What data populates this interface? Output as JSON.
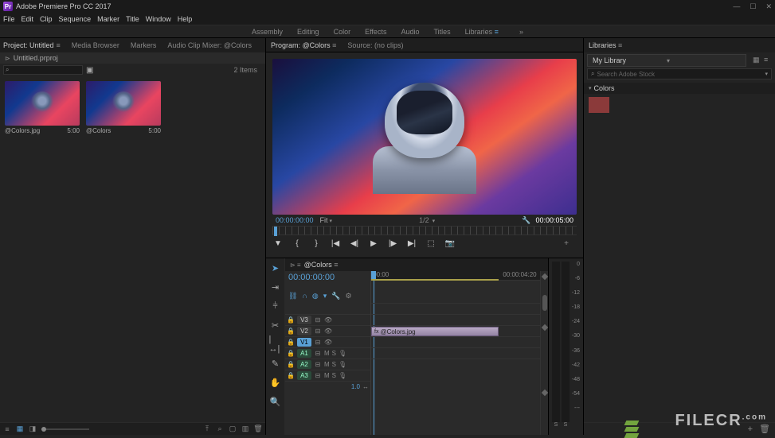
{
  "app": {
    "title": "Adobe Premiere Pro CC 2017"
  },
  "menu": [
    "File",
    "Edit",
    "Clip",
    "Sequence",
    "Marker",
    "Title",
    "Window",
    "Help"
  ],
  "workspaces": {
    "items": [
      "Assembly",
      "Editing",
      "Color",
      "Effects",
      "Audio",
      "Titles",
      "Libraries"
    ],
    "active": "Libraries"
  },
  "project": {
    "tabs": [
      "Project: Untitled",
      "Media Browser",
      "Markers",
      "Audio Clip Mixer: @Colors"
    ],
    "active_tab": "Project: Untitled",
    "breadcrumb": "Untitled.prproj",
    "item_count": "2 Items",
    "clips": [
      {
        "name": "@Colors.jpg",
        "duration": "5:00"
      },
      {
        "name": "@Colors",
        "duration": "5:00"
      }
    ]
  },
  "source_tabs": {
    "items": [
      "Program: @Colors",
      "Source: (no clips)"
    ],
    "active": "Program: @Colors"
  },
  "monitor": {
    "tc_left": "00:00:00:00",
    "fit": "Fit",
    "ratio": "1/2",
    "tc_right": "00:00:05:00"
  },
  "timeline": {
    "sequence_name": "@Colors",
    "tc": "00:00:00:00",
    "ruler_ticks": [
      {
        "pos": "0%",
        "label": ":00:00"
      },
      {
        "pos": "80%",
        "label": "00:00:04:20"
      }
    ],
    "video_tracks": [
      {
        "label": "V3",
        "active": false
      },
      {
        "label": "V2",
        "active": false
      },
      {
        "label": "V1",
        "active": true,
        "clip": "@Colors.jpg"
      }
    ],
    "audio_tracks": [
      {
        "label": "A1",
        "mute": "M",
        "solo": "S"
      },
      {
        "label": "A2",
        "mute": "M",
        "solo": "S"
      },
      {
        "label": "A3",
        "mute": "M",
        "solo": "S"
      }
    ],
    "zoom_label": "1.0"
  },
  "audio_meter": {
    "scale": [
      "0",
      "-6",
      "-12",
      "-18",
      "-24",
      "-30",
      "-36",
      "-42",
      "-48",
      "-54",
      "---"
    ],
    "channels": [
      "S",
      "S"
    ]
  },
  "libraries": {
    "tab": "Libraries",
    "dropdown": "My Library",
    "search_placeholder": "Search Adobe Stock",
    "section": "Colors",
    "swatch_color": "#8b3a3a"
  },
  "watermark": "FILECR"
}
